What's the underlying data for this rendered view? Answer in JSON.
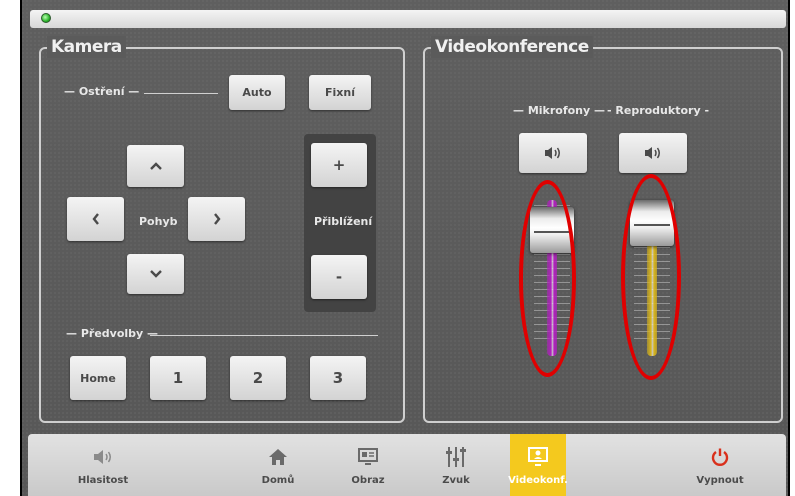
{
  "camera": {
    "title": "Kamera",
    "focus": {
      "label": "— Ostření —",
      "auto": "Auto",
      "fixed": "Fixní"
    },
    "move": {
      "label": "Pohyb",
      "up": "⌃",
      "down": "⌄",
      "left": "<",
      "right": ">"
    },
    "zoom": {
      "label": "Přiblížení",
      "plus": "+",
      "minus": "-"
    },
    "presets": {
      "label": "— Předvolby —",
      "home": "Home",
      "p1": "1",
      "p2": "2",
      "p3": "3"
    }
  },
  "videoconf": {
    "title": "Videokonference",
    "microphones": {
      "label": "— Mikrofony —",
      "level": 0.85,
      "color": "#b21fc0"
    },
    "speakers": {
      "label": "- Reproduktory -",
      "level": 0.9,
      "color": "#d9b51a"
    }
  },
  "taskbar": {
    "volume": "Hlasitost",
    "home": "Domů",
    "picture": "Obraz",
    "sound": "Zvuk",
    "videoconf": "Videokonf.",
    "power": "Vypnout"
  },
  "colors": {
    "accent": "#f4c91e",
    "power": "#d9301c",
    "highlight": "#e00000"
  }
}
